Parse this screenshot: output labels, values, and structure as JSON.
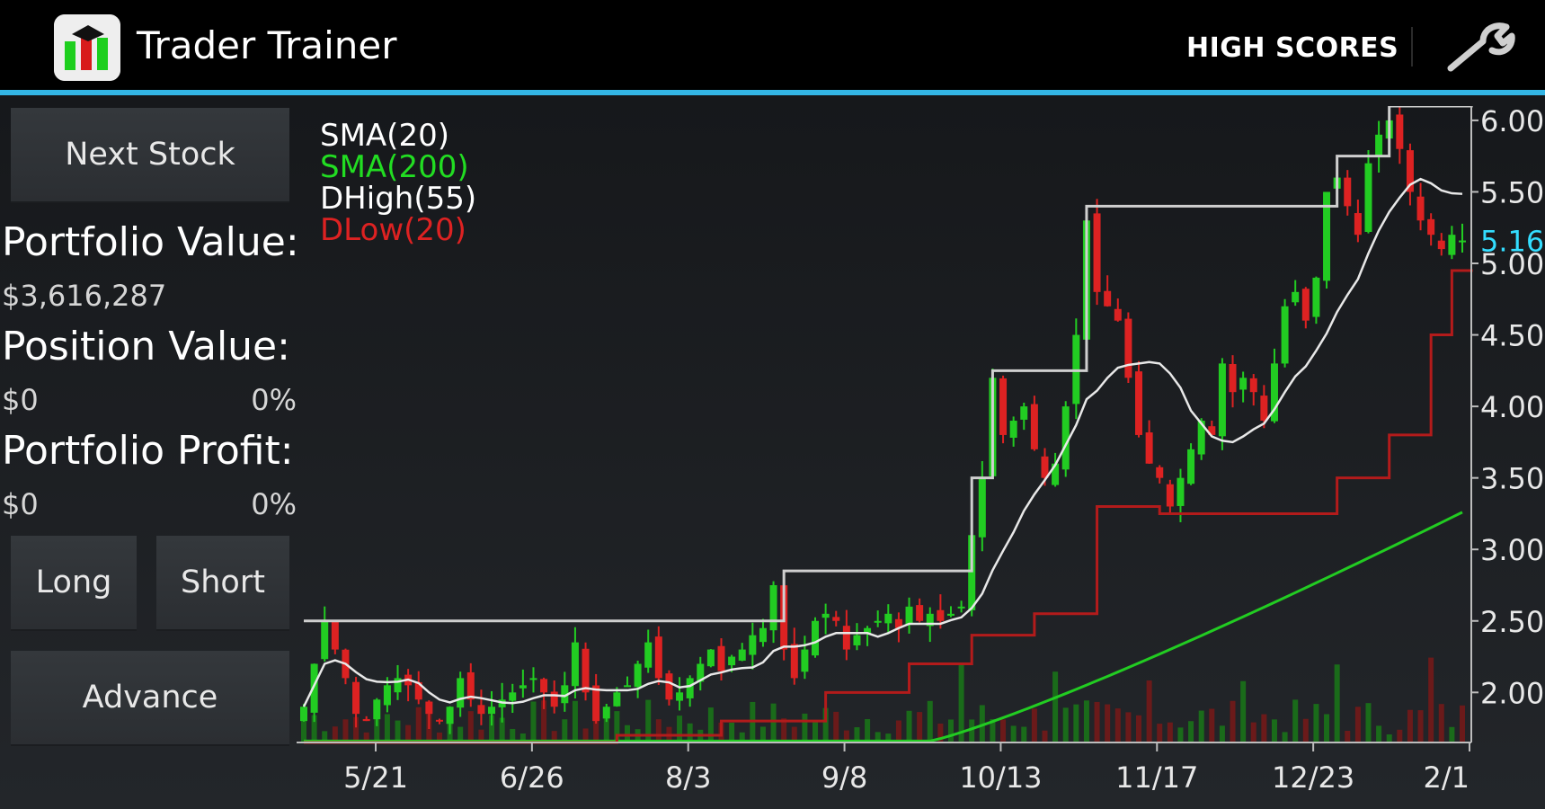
{
  "app": {
    "title": "Trader Trainer",
    "icon": "trader-trainer-app-icon"
  },
  "action_bar": {
    "high_scores_label": "HIGH SCORES",
    "settings_icon": "wrench-icon",
    "accent_color": "#33b5e5"
  },
  "panel": {
    "next_stock_label": "Next Stock",
    "portfolio_value_label": "Portfolio Value:",
    "portfolio_value": "$3,616,287",
    "position_value_label": "Position Value:",
    "position_value": "$0",
    "position_pct": "0%",
    "portfolio_profit_label": "Portfolio Profit:",
    "portfolio_profit": "$0",
    "profit_pct": "0%",
    "long_label": "Long",
    "short_label": "Short",
    "advance_label": "Advance"
  },
  "chart_data": {
    "type": "candlestick",
    "legend": [
      {
        "name": "SMA(20)",
        "color": "#ffffff"
      },
      {
        "name": "SMA(200)",
        "color": "#22dd22"
      },
      {
        "name": "DHigh(55)",
        "color": "#ffffff"
      },
      {
        "name": "DLow(20)",
        "color": "#dd2222"
      }
    ],
    "x_ticks": [
      "5/21",
      "6/26",
      "8/3",
      "9/8",
      "10/13",
      "11/17",
      "12/23",
      "2/1"
    ],
    "y_ticks": [
      "2.00",
      "2.50",
      "3.00",
      "3.50",
      "4.00",
      "4.50",
      "5.00",
      "5.50",
      "6.00"
    ],
    "y_range": [
      1.65,
      6.1
    ],
    "current_price": "5.16",
    "current_price_color": "#33ddff",
    "close_series": [
      1.9,
      2.2,
      2.5,
      2.3,
      2.1,
      1.85,
      1.8,
      1.95,
      2.05,
      2.1,
      2.05,
      1.95,
      1.85,
      1.8,
      1.9,
      2.1,
      1.95,
      1.85,
      1.9,
      1.95,
      2.0,
      2.05,
      2.1,
      2.0,
      1.9,
      2.05,
      2.35,
      2.0,
      1.8,
      1.9,
      2.0,
      2.05,
      2.2,
      2.35,
      2.1,
      1.95,
      2.0,
      2.1,
      2.2,
      2.3,
      2.15,
      2.25,
      2.3,
      2.4,
      2.45,
      2.75,
      2.3,
      2.1,
      2.3,
      2.5,
      2.55,
      2.5,
      2.3,
      2.4,
      2.45,
      2.5,
      2.55,
      2.45,
      2.6,
      2.5,
      2.55,
      2.5,
      2.55,
      2.6,
      3.1,
      3.5,
      4.2,
      3.8,
      3.9,
      4.0,
      3.7,
      3.5,
      3.6,
      4.0,
      4.5,
      5.3,
      4.8,
      4.7,
      4.6,
      4.2,
      3.8,
      3.6,
      3.5,
      3.3,
      3.5,
      3.7,
      3.9,
      3.8,
      4.3,
      4.1,
      4.2,
      4.1,
      3.9,
      4.3,
      4.7,
      4.8,
      4.6,
      4.9,
      5.5,
      5.6,
      5.4,
      5.2,
      5.7,
      5.9,
      6.0,
      5.8,
      5.5,
      5.3,
      5.2,
      5.1,
      5.2,
      5.16
    ],
    "dhigh_series": [
      [
        0,
        2.5
      ],
      [
        45,
        2.5
      ],
      [
        46,
        2.85
      ],
      [
        63,
        2.85
      ],
      [
        64,
        3.5
      ],
      [
        66,
        4.25
      ],
      [
        74,
        4.25
      ],
      [
        75,
        5.4
      ],
      [
        98,
        5.4
      ],
      [
        99,
        5.75
      ],
      [
        103,
        5.75
      ],
      [
        104,
        6.1
      ],
      [
        112,
        6.1
      ]
    ],
    "dlow_series": [
      [
        0,
        1.65
      ],
      [
        20,
        1.65
      ],
      [
        30,
        1.7
      ],
      [
        40,
        1.8
      ],
      [
        50,
        2.0
      ],
      [
        58,
        2.2
      ],
      [
        64,
        2.4
      ],
      [
        70,
        2.55
      ],
      [
        76,
        3.3
      ],
      [
        80,
        3.3
      ],
      [
        82,
        3.25
      ],
      [
        96,
        3.25
      ],
      [
        99,
        3.5
      ],
      [
        104,
        3.8
      ],
      [
        108,
        4.5
      ],
      [
        110,
        4.95
      ],
      [
        112,
        4.95
      ]
    ],
    "volume_present": true
  }
}
